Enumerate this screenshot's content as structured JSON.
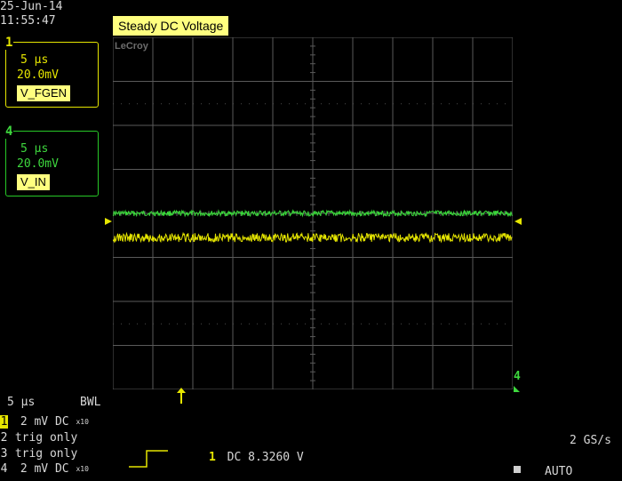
{
  "header": {
    "date": "25-Jun-14",
    "time": "11:55:47",
    "title": "Steady DC Voltage",
    "brand": "LeCroy"
  },
  "channels": [
    {
      "num": "1",
      "timebase": "5 µs",
      "volts": "20.0mV",
      "name": "V_FGEN",
      "color": "#e6e600"
    },
    {
      "num": "4",
      "timebase": "5 µs",
      "volts": "20.0mV",
      "name": "V_IN",
      "color": "#3ed83e"
    }
  ],
  "traces": {
    "ch4_level_div": 0.0,
    "ch1_level_div": -0.55
  },
  "bottom": {
    "timebase": "5 µs",
    "bwl": "BWL",
    "rows": [
      {
        "num": "1",
        "text": "2 mV  DC",
        "coupling_mark": "x10",
        "color": "#e6e600"
      },
      {
        "num": "2",
        "text": "trig only",
        "color": "#ff6ec7"
      },
      {
        "num": "3",
        "text": "trig only",
        "color": "#5aa0ff"
      },
      {
        "num": "4",
        "text": "2 mV  DC",
        "coupling_mark": "x10",
        "color": "#3ed83e"
      }
    ],
    "trigger_channel": "1",
    "trigger_text": "DC 8.3260 V",
    "sample_rate": "2 GS/s",
    "mode": "AUTO",
    "ch4_marker": "4"
  }
}
